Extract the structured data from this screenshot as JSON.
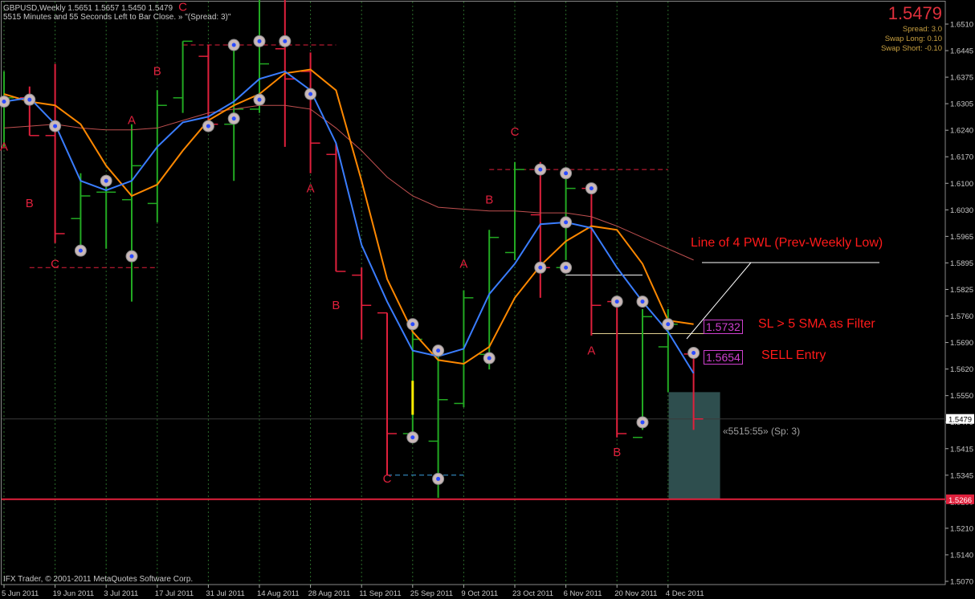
{
  "header": {
    "symbol_line": "GBPUSD,Weekly  1.5651 1.5657 1.5450 1.5479",
    "status_line": "5515 Minutes and 55 Seconds Left to Bar Close. » \"(Spread: 3)\""
  },
  "price_panel": {
    "current_price": "1.5479",
    "spread": "Spread: 3.0",
    "swap_long": "Swap Long: 0.10",
    "swap_short": "Swap Short: -0.10"
  },
  "copyright": "IFX Trader, © 2001-2011 MetaQuotes Software Corp.",
  "annotations": {
    "pwl_label": "Line of 4 PWL (Prev-Weekly Low)",
    "sl_label": "SL > 5 SMA as Filter",
    "sell_label": "SELL Entry",
    "sl_price": "1.5732",
    "entry_price": "1.5654",
    "timer": "«5515:55» (Sp: 3)"
  },
  "price_axis": {
    "labels": [
      "1.6510",
      "1.6445",
      "1.6375",
      "1.6305",
      "1.6240",
      "1.6170",
      "1.6100",
      "1.6030",
      "1.5965",
      "1.5895",
      "1.5825",
      "1.5760",
      "1.5690",
      "1.5620",
      "1.5550",
      "1.5479",
      "1.5415",
      "1.5345",
      "1.5280",
      "1.5210",
      "1.5140",
      "1.5070"
    ],
    "current_tag": "1.5479",
    "line_tag": "1.5266"
  },
  "time_axis": {
    "labels": [
      "5 Jun 2011",
      "19 Jun 2011",
      "3 Jul 2011",
      "17 Jul 2011",
      "31 Jul 2011",
      "14 Aug 2011",
      "28 Aug 2011",
      "11 Sep 2011",
      "25 Sep 2011",
      "9 Oct 2011",
      "23 Oct 2011",
      "6 Nov 2011",
      "20 Nov 2011",
      "4 Dec 2011"
    ]
  },
  "colors": {
    "bull_bar": "#22aa22",
    "bear_bar": "#e0203c",
    "fast_ma": "#3a7dff",
    "slow_ma": "#ff8800",
    "long_ma": "#c05050",
    "horizontal_line": "#e0203c",
    "entry_box": "#2e4e4e"
  },
  "chart_data": {
    "type": "ohlc",
    "symbol": "GBPUSD",
    "timeframe": "Weekly",
    "ylim": [
      1.504,
      1.6585
    ],
    "bars": [
      {
        "o": 1.631,
        "h": 1.64,
        "l": 1.62,
        "c": 1.633
      },
      {
        "o": 1.633,
        "h": 1.636,
        "l": 1.623,
        "c": 1.623
      },
      {
        "o": 1.623,
        "h": 1.642,
        "l": 1.5945,
        "c": 1.597
      },
      {
        "o": 1.601,
        "h": 1.613,
        "l": 1.592,
        "c": 1.607
      },
      {
        "o": 1.608,
        "h": 1.611,
        "l": 1.593,
        "c": 1.608
      },
      {
        "o": 1.606,
        "h": 1.626,
        "l": 1.579,
        "c": 1.615
      },
      {
        "o": 1.605,
        "h": 1.635,
        "l": 1.6,
        "c": 1.631
      },
      {
        "o": 1.633,
        "h": 1.648,
        "l": 1.629,
        "c": 1.648
      },
      {
        "o": 1.644,
        "h": 1.647,
        "l": 1.624,
        "c": 1.626
      },
      {
        "o": 1.626,
        "h": 1.648,
        "l": 1.611,
        "c": 1.63
      },
      {
        "o": 1.63,
        "h": 1.659,
        "l": 1.629,
        "c": 1.642
      },
      {
        "o": 1.646,
        "h": 1.659,
        "l": 1.62,
        "c": 1.638
      },
      {
        "o": 1.64,
        "h": 1.645,
        "l": 1.613,
        "c": 1.621
      },
      {
        "o": 1.618,
        "h": 1.621,
        "l": 1.587,
        "c": 1.587
      },
      {
        "o": 1.586,
        "h": 1.588,
        "l": 1.569,
        "c": 1.578
      },
      {
        "o": 1.576,
        "h": 1.576,
        "l": 1.533,
        "c": 1.544
      },
      {
        "o": 1.544,
        "h": 1.574,
        "l": 1.543,
        "c": 1.569
      },
      {
        "o": 1.542,
        "h": 1.566,
        "l": 1.527,
        "c": 1.553
      },
      {
        "o": 1.552,
        "h": 1.582,
        "l": 1.551,
        "c": 1.58
      },
      {
        "o": 1.565,
        "h": 1.598,
        "l": 1.561,
        "c": 1.596
      },
      {
        "o": 1.592,
        "h": 1.616,
        "l": 1.59,
        "c": 1.614
      },
      {
        "o": 1.602,
        "h": 1.616,
        "l": 1.58,
        "c": 1.588
      },
      {
        "o": 1.588,
        "h": 1.614,
        "l": 1.59,
        "c": 1.609
      },
      {
        "o": 1.609,
        "h": 1.609,
        "l": 1.57,
        "c": 1.578
      },
      {
        "o": 1.579,
        "h": 1.579,
        "l": 1.543,
        "c": 1.544
      },
      {
        "o": 1.543,
        "h": 1.577,
        "l": 1.545,
        "c": 1.575
      },
      {
        "o": 1.567,
        "h": 1.577,
        "l": 1.555,
        "c": 1.573
      },
      {
        "o": 1.5651,
        "h": 1.5657,
        "l": 1.545,
        "c": 1.5479
      }
    ],
    "wave_labels": [
      {
        "bar": 0,
        "text": "A",
        "price": 1.619
      },
      {
        "bar": 1,
        "text": "B",
        "price": 1.604
      },
      {
        "bar": 2,
        "text": "C",
        "price": 1.588
      },
      {
        "bar": 5,
        "text": "A",
        "price": 1.626
      },
      {
        "bar": 6,
        "text": "B",
        "price": 1.639
      },
      {
        "bar": 7,
        "text": "C",
        "price": 1.656
      },
      {
        "bar": 12,
        "text": "A",
        "price": 1.608
      },
      {
        "bar": 13,
        "text": "B",
        "price": 1.577
      },
      {
        "bar": 15,
        "text": "C",
        "price": 1.531
      },
      {
        "bar": 18,
        "text": "A",
        "price": 1.588
      },
      {
        "bar": 19,
        "text": "B",
        "price": 1.605
      },
      {
        "bar": 20,
        "text": "C",
        "price": 1.623
      },
      {
        "bar": 23,
        "text": "A",
        "price": 1.565
      },
      {
        "bar": 24,
        "text": "B",
        "price": 1.538
      }
    ],
    "fast_ma": [
      1.632,
      1.633,
      1.626,
      1.611,
      1.6085,
      1.611,
      1.62,
      1.6265,
      1.628,
      1.632,
      1.638,
      1.64,
      1.635,
      1.621,
      1.594,
      1.579,
      1.566,
      1.5645,
      1.5665,
      1.581,
      1.589,
      1.5995,
      1.6,
      1.5985,
      1.588,
      1.579,
      1.571,
      1.56
    ],
    "slow_ma": [
      1.634,
      1.632,
      1.631,
      1.626,
      1.615,
      1.607,
      1.61,
      1.619,
      1.627,
      1.631,
      1.634,
      1.6395,
      1.6405,
      1.635,
      1.611,
      1.585,
      1.571,
      1.5635,
      1.5625,
      1.567,
      1.58,
      1.5885,
      1.595,
      1.599,
      1.598,
      1.589,
      1.574,
      1.573
    ],
    "long_ma": [
      1.625,
      1.6255,
      1.626,
      1.625,
      1.6245,
      1.6245,
      1.625,
      1.627,
      1.629,
      1.63,
      1.631,
      1.631,
      1.63,
      1.625,
      1.619,
      1.612,
      1.607,
      1.604,
      1.6035,
      1.603,
      1.603,
      1.6025,
      1.6025,
      1.6015,
      1.599,
      1.596,
      1.593,
      1.59
    ]
  }
}
